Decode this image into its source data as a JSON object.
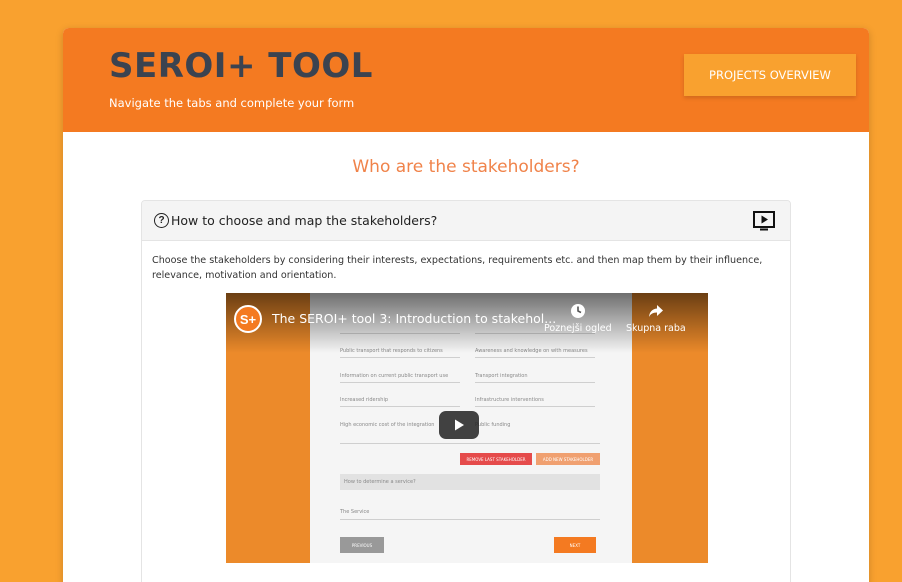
{
  "header": {
    "title": "SEROI+ TOOL",
    "subtitle": "Navigate the tabs and complete your form",
    "projects_button": "PROJECTS OVERVIEW"
  },
  "main": {
    "question": "Who are the stakeholders?",
    "panel": {
      "title": "How to choose and map the stakeholders?",
      "text": "Choose the stakeholders by considering their interests, expectations, requirements etc. and then map them by their influence, relevance, motivation and orientation."
    }
  },
  "video": {
    "channel_logo": "S+",
    "title": "The SEROI+ tool 3: Introduction to stakehol...",
    "watch_later": "Poznejši ogled",
    "share": "Skupna raba",
    "frame": {
      "stakeholder_fields": [
        "Public transport that responds to citizens",
        "Awareness and knowledge on with measures",
        "Information on current public transport use",
        "Transport integration",
        "Increased ridership",
        "Infrastructure interventions",
        "High economic cost of the integration",
        "Public funding"
      ],
      "remove_button": "REMOVE LAST STAKEHOLDER",
      "add_button": "ADD NEW STAKEHOLDER",
      "next_question": "How to determine a service?",
      "service_label": "The Service",
      "previous_button": "PREVIOUS",
      "next_button": "NEXT"
    }
  },
  "colors": {
    "page_background": "#f9a12f",
    "header_background": "#f47a21",
    "title_text": "#3b4350",
    "question_text": "#f0834a"
  },
  "icons": [
    "question-circle-icon",
    "video-play-icon",
    "clock-icon",
    "share-arrow-icon",
    "youtube-play-icon"
  ]
}
